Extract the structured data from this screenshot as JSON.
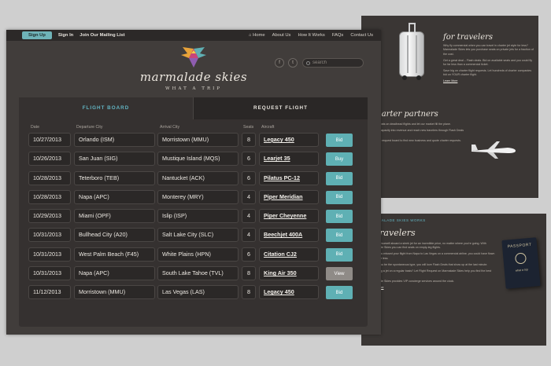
{
  "topbar": {
    "signup": "Sign Up",
    "signin": "Sign In",
    "mailing": "Join Our Mailing List",
    "nav": [
      "Home",
      "About Us",
      "How It Works",
      "FAQs",
      "Contact Us"
    ]
  },
  "brand": {
    "name": "marmalade skies",
    "tagline": "WHAT A TRIP"
  },
  "search": {
    "placeholder": "search"
  },
  "tabs": [
    "FLIGHT BOARD",
    "REQUEST FLIGHT"
  ],
  "columns": [
    "Date",
    "Departure City",
    "Arrival City",
    "Seats",
    "Aircraft"
  ],
  "rows": [
    {
      "date": "10/27/2013",
      "dep": "Orlando (ISM)",
      "arr": "Morristown (MMU)",
      "seats": "8",
      "aircraft": "Legacy 450",
      "action": "Bid",
      "color": "#5fb0b4"
    },
    {
      "date": "10/26/2013",
      "dep": "San Juan (SIG)",
      "arr": "Mustique Island (MQS)",
      "seats": "6",
      "aircraft": "Learjet 35",
      "action": "Buy",
      "color": "#5fb0b4"
    },
    {
      "date": "10/28/2013",
      "dep": "Teterboro (TEB)",
      "arr": "Nantucket (ACK)",
      "seats": "6",
      "aircraft": "Pilatus PC-12",
      "action": "Bid",
      "color": "#5fb0b4"
    },
    {
      "date": "10/28/2013",
      "dep": "Napa (APC)",
      "arr": "Monterey (MRY)",
      "seats": "4",
      "aircraft": "Piper Meridian",
      "action": "Bid",
      "color": "#5fb0b4"
    },
    {
      "date": "10/29/2013",
      "dep": "Miami (OPF)",
      "arr": "Islip (ISP)",
      "seats": "4",
      "aircraft": "Piper Cheyenne",
      "action": "Bid",
      "color": "#5fb0b4"
    },
    {
      "date": "10/31/2013",
      "dep": "Bullhead City (A20)",
      "arr": "Salt Lake City (SLC)",
      "seats": "4",
      "aircraft": "Beechjet 400A",
      "action": "Bid",
      "color": "#5fb0b4"
    },
    {
      "date": "10/31/2013",
      "dep": "West Palm Beach (F45)",
      "arr": "White Plains (HPN)",
      "seats": "6",
      "aircraft": "Citation CJ2",
      "action": "Bid",
      "color": "#5fb0b4"
    },
    {
      "date": "10/31/2013",
      "dep": "Napa (APC)",
      "arr": "South Lake Tahoe (TVL)",
      "seats": "8",
      "aircraft": "King Air 350",
      "action": "View",
      "color": "#8f8b87"
    },
    {
      "date": "11/12/2013",
      "dep": "Morristown (MMU)",
      "arr": "Las Vegas (LAS)",
      "seats": "8",
      "aircraft": "Legacy 450",
      "action": "Bid",
      "color": "#5fb0b4"
    }
  ],
  "side_top": {
    "heading1": "for travelers",
    "p1": "Why fly commercial when you can travel in charter jet style for less? Marmalade Skies lets you purchase seats on private jets for a fraction of the cost.",
    "p2": "Get a great deal – Flash deals. Bid on available seats and you could fly for far less than a commercial ticket.",
    "p3": "Save big on charter flight requests. Let hundreds of charter companies bid on YOUR charter flight.",
    "learn_more": "Learn More",
    "heading2": "for charter partners",
    "p4": "Sell empty seats on deadhead flights and let our market fill the plane.",
    "p5": "Get unused capacity into revenue and reach new travelers through Flash Deals and bids.",
    "p6": "Use our flight request board to find new business and quote charter requests."
  },
  "side_bottom": {
    "heading_small": "MARMALADE SKIES WORKS",
    "heading": "r travelers",
    "passport": "PASSPORT",
    "passport_sub": "what a trip",
    "p1": "Imagine yourself aboard a sleek jet for an incredible price, no matter where you're going. With Marmalade Skies you can find seats on empty-leg flights.",
    "p2": "Before you missed your flight from Napa to Las Vegas on a commercial airline, you could have flown private for less.",
    "p3": "Should you be the spontaneous type, you will love Flash Deals that show up at the last minute.",
    "p4": "Chartering a jet on a regular basis? Let Flight Request on Marmalade Skies help you find the best charter.",
    "p5": "Marmalade Skies provides VIP concierge services around the clock.",
    "learn_more": "Learn More"
  }
}
